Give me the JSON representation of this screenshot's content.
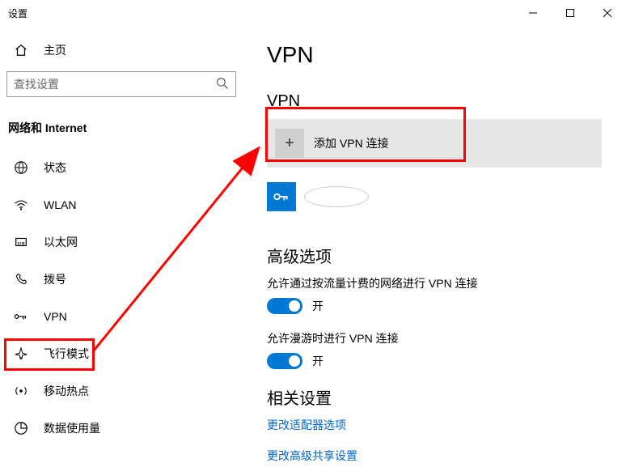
{
  "titlebar": {
    "title": "设置"
  },
  "sidebar": {
    "home": "主页",
    "search_placeholder": "查找设置",
    "category": "网络和 Internet",
    "items": [
      {
        "label": "状态"
      },
      {
        "label": "WLAN"
      },
      {
        "label": "以太网"
      },
      {
        "label": "拨号"
      },
      {
        "label": "VPN"
      },
      {
        "label": "飞行模式"
      },
      {
        "label": "移动热点"
      },
      {
        "label": "数据使用量"
      }
    ]
  },
  "main": {
    "page_title": "VPN",
    "section_vpn": "VPN",
    "add_vpn": "添加 VPN 连接",
    "section_adv": "高级选项",
    "opt_metered": "允许通过按流量计费的网络进行 VPN 连接",
    "opt_roaming": "允许漫游时进行 VPN 连接",
    "on_label": "开",
    "section_related": "相关设置",
    "link_adapter": "更改适配器选项",
    "link_sharing": "更改高级共享设置"
  }
}
